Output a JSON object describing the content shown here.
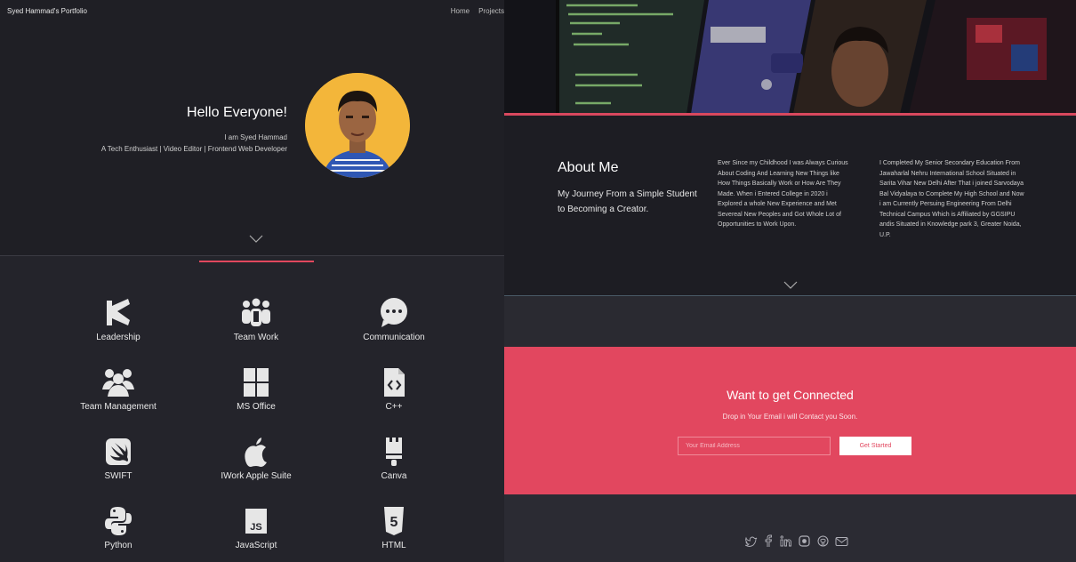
{
  "left": {
    "brand": "Syed Hammad's Portfolio",
    "nav": [
      "Home",
      "Projects"
    ],
    "hero": {
      "title": "Hello Everyone!",
      "line1": "I am Syed Hammad",
      "line2": "A Tech Enthusiast | Video Editor | Frontend Web Developer"
    },
    "skills": [
      {
        "label": "Leadership",
        "icon": "megaphone-icon"
      },
      {
        "label": "Team Work",
        "icon": "team-icon"
      },
      {
        "label": "Communication",
        "icon": "chat-icon"
      },
      {
        "label": "Team Management",
        "icon": "users-icon"
      },
      {
        "label": "MS Office",
        "icon": "windows-icon"
      },
      {
        "label": "C++",
        "icon": "code-file-icon"
      },
      {
        "label": "SWIFT",
        "icon": "swift-icon"
      },
      {
        "label": "IWork Apple Suite",
        "icon": "apple-icon"
      },
      {
        "label": "Canva",
        "icon": "brush-icon"
      },
      {
        "label": "Python",
        "icon": "python-icon"
      },
      {
        "label": "JavaScript",
        "icon": "js-icon",
        "badge": "JS"
      },
      {
        "label": "HTML",
        "icon": "html5-icon",
        "badge": "5"
      }
    ]
  },
  "right": {
    "about": {
      "title": "About Me",
      "subtitle": "My Journey From a Simple Student to Becoming a Creator.",
      "col1": "Ever Since my Childhood I was Always Curious About Coding And Learning New Things like How Things Basically Work or How Are They Made. When i Entered College in 2020 i Explored a whole New Experience and Met Severeal New Peoples and Got Whole Lot of Opportunities to Work Upon.",
      "col2": "I Completed My Senior Secondary Education From Jawaharlal Nehru International School Situated in Sarita Vihar New Delhi After That i joined Sarvodaya Bal Vidyalaya to Complete My High School and Now i am Currently Persuing Engineering From Delhi Technical Campus Which is Affiliated by GGSIPU andis Situated in Knowledge park 3, Greater Noida, U.P."
    },
    "connect": {
      "title": "Want to get Connected",
      "subtitle": "Drop in Your Email i will Contact you Soon.",
      "email_placeholder": "Your Email Address",
      "button": "Get Started"
    },
    "social": [
      "twitter-icon",
      "facebook-icon",
      "linkedin-icon",
      "instagram-icon",
      "github-icon",
      "email-icon"
    ]
  },
  "colors": {
    "accent": "#e2475f",
    "bg_dark": "#24242b"
  }
}
